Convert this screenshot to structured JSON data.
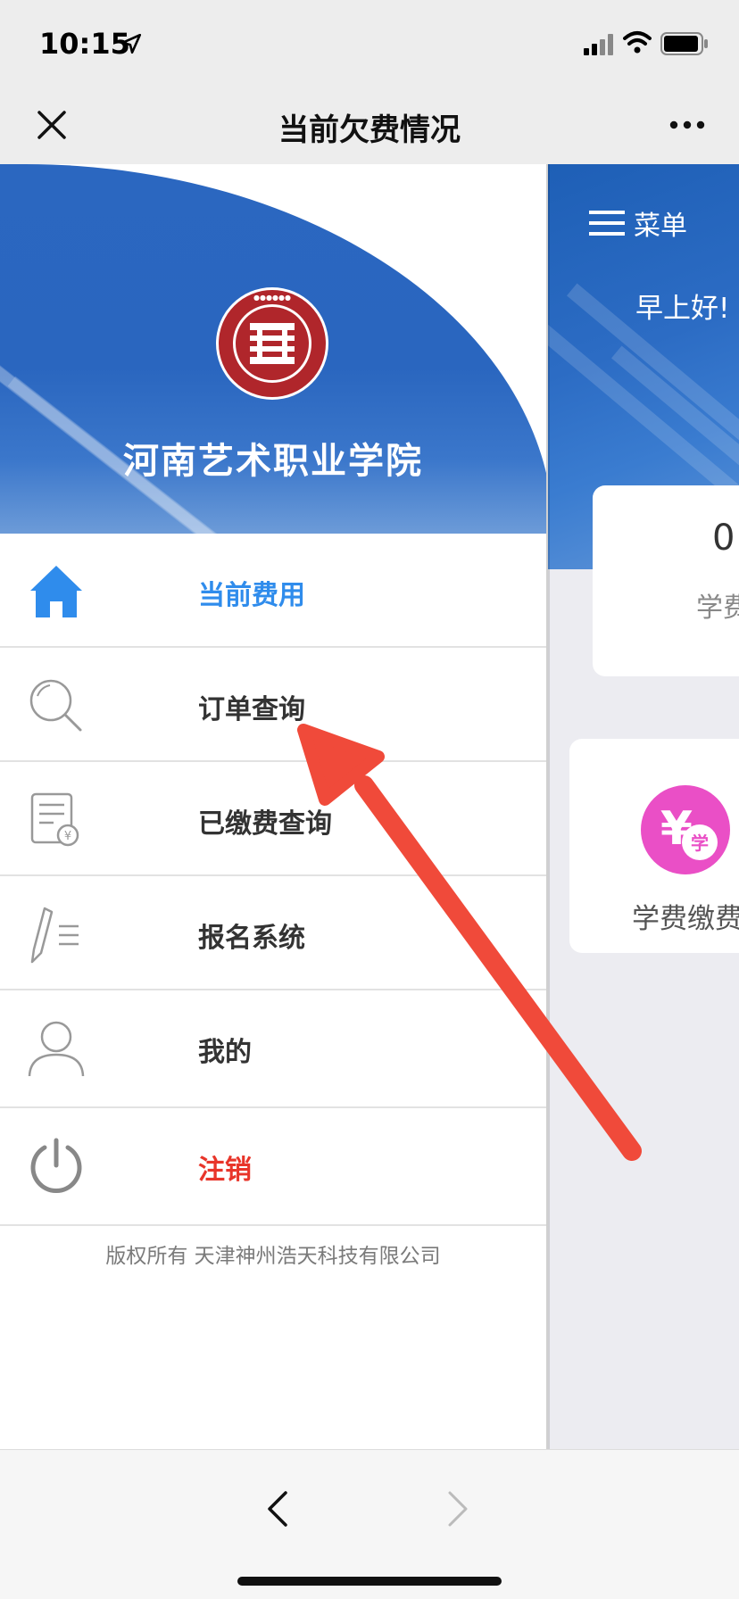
{
  "status_bar": {
    "time": "10:15",
    "icons": [
      "location-arrow-icon",
      "cellular-signal-icon",
      "wifi-icon",
      "battery-icon"
    ]
  },
  "nav_bar": {
    "title": "当前欠费情况",
    "left_icon": "close-icon",
    "right_icon": "more-icon"
  },
  "drawer": {
    "school_name": "河南艺术职业学院",
    "logo_caption": "HENAN VOCATIONAL COLLEGE OF ART",
    "menu_items": [
      {
        "label": "当前费用",
        "icon": "home-icon",
        "state": "active"
      },
      {
        "label": "订单查询",
        "icon": "search-icon",
        "state": "normal"
      },
      {
        "label": "已缴费查询",
        "icon": "receipt-icon",
        "state": "normal"
      },
      {
        "label": "报名系统",
        "icon": "pen-list-icon",
        "state": "normal"
      },
      {
        "label": "我的",
        "icon": "user-icon",
        "state": "normal"
      },
      {
        "label": "注销",
        "icon": "power-icon",
        "state": "danger"
      }
    ],
    "copyright": "版权所有 天津神州浩天科技有限公司"
  },
  "background_page": {
    "menu_label": "菜单",
    "greeting": "早上好!",
    "card_value": "0",
    "card_label": "学费",
    "fee_button_label": "学费缴费",
    "fee_icon_text": "学"
  },
  "colors": {
    "active": "#2f8cec",
    "danger": "#e8352a",
    "banner_blue": "#2b67c0",
    "fee_pink": "#ea4fc6",
    "arrow_red": "#f04a3a"
  },
  "toolbar": {
    "back_icon": "chevron-left-icon",
    "forward_icon": "chevron-right-icon"
  }
}
